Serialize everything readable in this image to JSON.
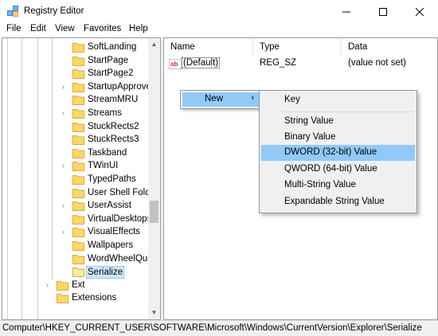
{
  "window": {
    "title": "Registry Editor"
  },
  "menu": [
    "File",
    "Edit",
    "View",
    "Favorites",
    "Help"
  ],
  "tree": {
    "items": [
      {
        "label": "SoftLanding",
        "expander": false
      },
      {
        "label": "StartPage",
        "expander": false
      },
      {
        "label": "StartPage2",
        "expander": false
      },
      {
        "label": "StartupApprove",
        "expander": true
      },
      {
        "label": "StreamMRU",
        "expander": false
      },
      {
        "label": "Streams",
        "expander": true
      },
      {
        "label": "StuckRects2",
        "expander": false
      },
      {
        "label": "StuckRects3",
        "expander": false
      },
      {
        "label": "Taskband",
        "expander": false
      },
      {
        "label": "TWinUI",
        "expander": true
      },
      {
        "label": "TypedPaths",
        "expander": false
      },
      {
        "label": "User Shell Folde",
        "expander": false
      },
      {
        "label": "UserAssist",
        "expander": true
      },
      {
        "label": "VirtualDesktops",
        "expander": false
      },
      {
        "label": "VisualEffects",
        "expander": true
      },
      {
        "label": "Wallpapers",
        "expander": false
      },
      {
        "label": "WordWheelQue",
        "expander": false
      },
      {
        "label": "Serialize",
        "expander": false,
        "selected": true
      },
      {
        "label": "Ext",
        "expander": true,
        "level": "parent"
      },
      {
        "label": "Extensions",
        "expander": false,
        "level": "parent"
      }
    ]
  },
  "list": {
    "columns": [
      "Name",
      "Type",
      "Data"
    ],
    "rows": [
      {
        "name": "(Default)",
        "type": "REG_SZ",
        "data": "(value not set)"
      }
    ]
  },
  "context_menu": {
    "new_label": "New",
    "submenu": {
      "items": [
        "Key",
        "String Value",
        "Binary Value",
        "DWORD (32-bit) Value",
        "QWORD (64-bit) Value",
        "Multi-String Value",
        "Expandable String Value"
      ],
      "highlighted": "DWORD (32-bit) Value"
    }
  },
  "status": {
    "path": "Computer\\HKEY_CURRENT_USER\\SOFTWARE\\Microsoft\\Windows\\CurrentVersion\\Explorer\\Serialize"
  },
  "colors": {
    "selection": "#cce8ff",
    "menu_highlight": "#91c9f7"
  }
}
